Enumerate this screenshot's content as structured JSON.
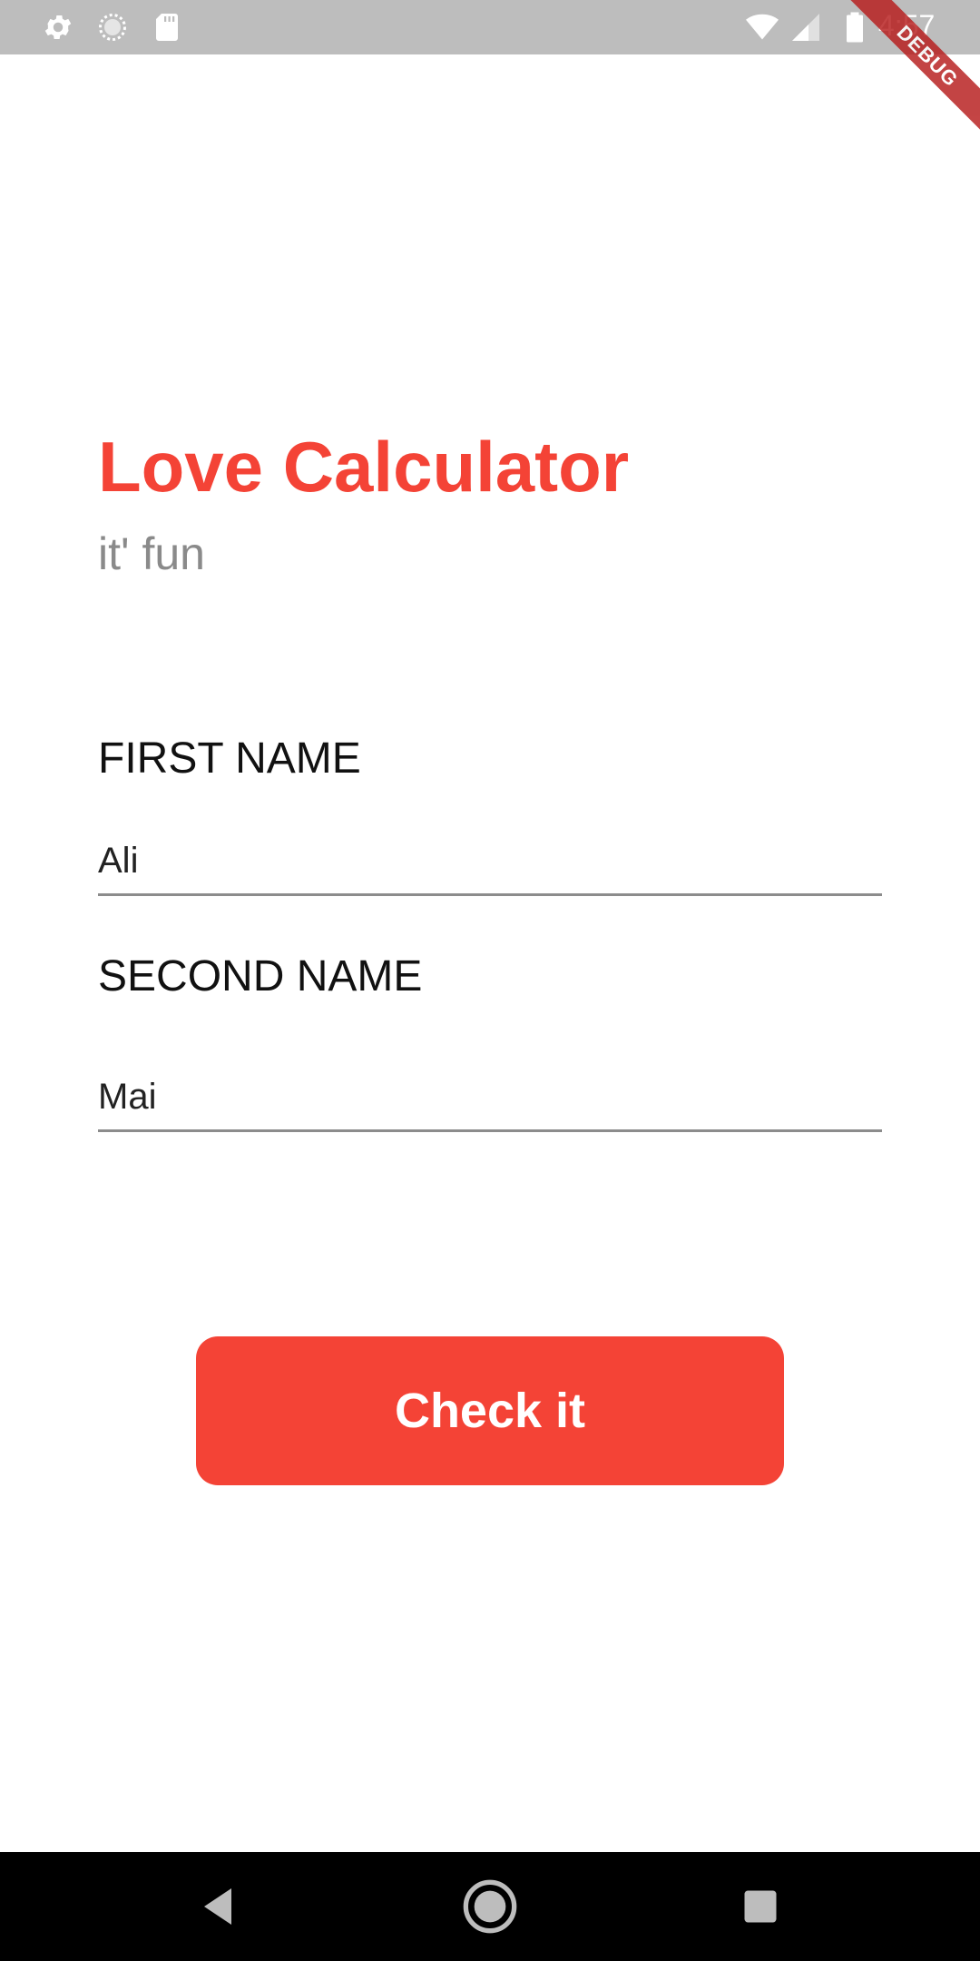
{
  "status_bar": {
    "time": "4:57",
    "left_icons": [
      "gear-icon",
      "loading-circle-icon",
      "sd-card-icon"
    ],
    "right_icons": [
      "wifi-icon",
      "cell-signal-icon",
      "battery-icon"
    ],
    "background": "#bdbdbd"
  },
  "debug_banner": {
    "label": "DEBUG"
  },
  "header": {
    "title": "Love Calculator",
    "subtitle": "it' fun"
  },
  "form": {
    "first_name": {
      "label": "FIRST NAME",
      "value": "Ali"
    },
    "second_name": {
      "label": "SECOND NAME",
      "value": "Mai"
    }
  },
  "actions": {
    "check_label": "Check it"
  },
  "nav_bar": {
    "items": [
      "back-icon",
      "home-icon",
      "recents-icon"
    ]
  },
  "colors": {
    "accent": "#f44336",
    "subtitle": "#8a8a8a",
    "underline": "#8c8c8c"
  }
}
